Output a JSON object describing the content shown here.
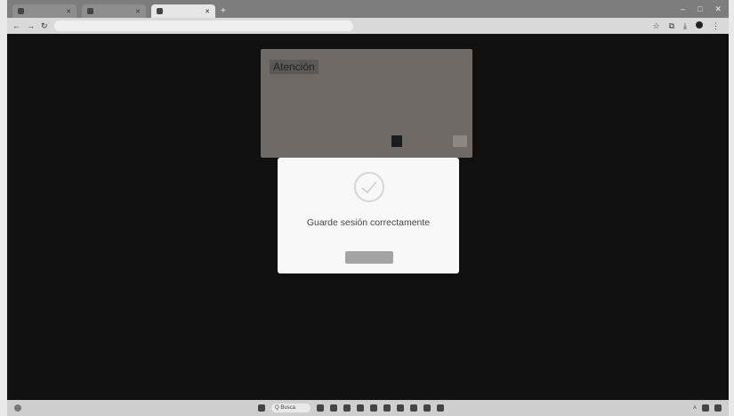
{
  "browser": {
    "tabs": [
      {
        "label": "",
        "active": false
      },
      {
        "label": "",
        "active": false
      },
      {
        "label": "",
        "active": true
      }
    ],
    "new_tab_symbol": "+",
    "window_controls": {
      "minimize": "–",
      "maximize": "□",
      "close": "✕"
    },
    "url": "",
    "nav": {
      "back": "←",
      "forward": "→",
      "reload": "↻"
    }
  },
  "atencion_card": {
    "title": "Atención",
    "body": "",
    "primary_button": "",
    "secondary_button": ""
  },
  "modal": {
    "message": "Guarde sesión correctamente",
    "ok_button": ""
  },
  "taskbar": {
    "search_placeholder": "Q Busca"
  },
  "colors": {
    "page_bg": "#101010",
    "modal_bg": "#f8f8f8",
    "card_bg": "#6f6a66",
    "ok_button": "#a4a4a4"
  }
}
